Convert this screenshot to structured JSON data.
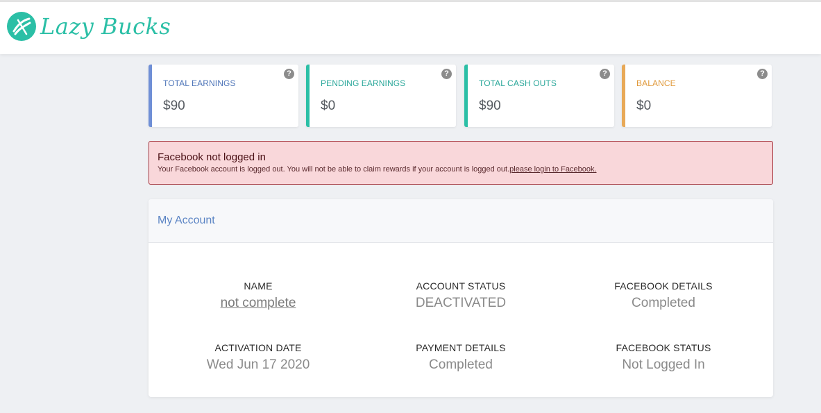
{
  "brand": {
    "name": "Lazy Bucks",
    "accent": "#2bbfa6"
  },
  "cards": [
    {
      "label": "TOTAL EARNINGS",
      "value": "$90",
      "color": "#6f8fd6",
      "label_color": "#4e75b8"
    },
    {
      "label": "PENDING EARNINGS",
      "value": "$0",
      "color": "#2bbfa6",
      "label_color": "#2aa79a"
    },
    {
      "label": "TOTAL CASH OUTS",
      "value": "$90",
      "color": "#2bbfa6",
      "label_color": "#2aa79a"
    },
    {
      "label": "BALANCE",
      "value": "$0",
      "color": "#e8a957",
      "label_color": "#e09a3c"
    }
  ],
  "help_glyph": "?",
  "alert": {
    "title": "Facebook not logged in",
    "message": "Your Facebook account is logged out. You will not be able to claim rewards if your account is logged out.",
    "link": "please login to Facebook."
  },
  "account": {
    "title": "My Account",
    "fields": {
      "name": {
        "label": "NAME",
        "value": "not complete"
      },
      "account_status": {
        "label": "ACCOUNT STATUS",
        "value": "DEACTIVATED"
      },
      "facebook_details": {
        "label": "FACEBOOK DETAILS",
        "value": "Completed"
      },
      "activation_date": {
        "label": "ACTIVATION DATE",
        "value": "Wed Jun 17 2020"
      },
      "payment_details": {
        "label": "PAYMENT DETAILS",
        "value": "Completed"
      },
      "facebook_status": {
        "label": "FACEBOOK STATUS",
        "value": "Not Logged In"
      }
    }
  }
}
